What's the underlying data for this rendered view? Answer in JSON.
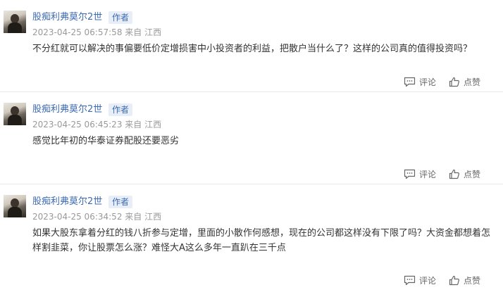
{
  "author_badge": "作者",
  "actions": {
    "comment_label": "评论",
    "like_label": "点赞"
  },
  "comments": [
    {
      "username": "股痴利弗莫尔2世",
      "meta": "2023-04-25 06:57:58 来自 江西",
      "text": "不分红就可以解决的事偏要低价定增损害中小投资者的利益，把散户当什么了？这样的公司真的值得投资吗？"
    },
    {
      "username": "股痴利弗莫尔2世",
      "meta": "2023-04-25 06:45:23 来自 江西",
      "text": "感觉比年初的华泰证券配股还要恶劣"
    },
    {
      "username": "股痴利弗莫尔2世",
      "meta": "2023-04-25 06:34:52 来自 江西",
      "text": "如果大股东拿着分红的钱八折参与定增，里面的小散作何感想，现在的公司都这样没有下限了吗？大资金都想着怎样割韭菜，你让股票怎么涨？难怪大A这么多年一直趴在三千点"
    }
  ],
  "colors": {
    "username": "#3d6ab0",
    "badge_bg": "#e8eef8",
    "meta": "#999999",
    "text": "#333333",
    "divider": "#e8e8e8"
  },
  "icons": {
    "avatar": "user-avatar-photo",
    "comment": "comment-bubble-icon",
    "like": "thumbs-up-icon"
  }
}
